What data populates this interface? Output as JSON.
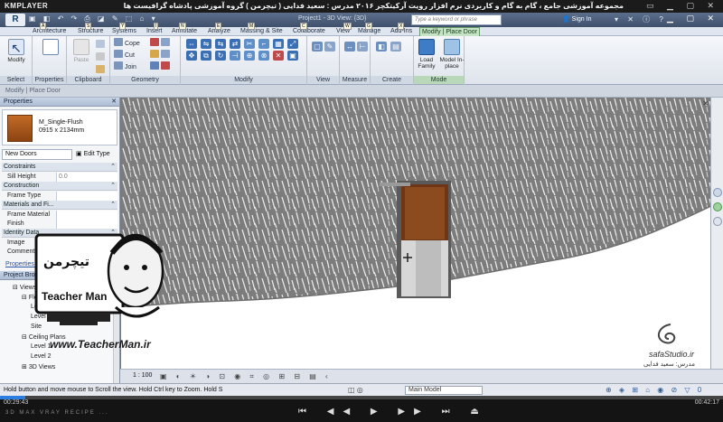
{
  "player": {
    "name": "KMPLAYER",
    "title": "مجموعه آموزشی جامع ، گام به گام و کاربردی نرم افزار رویت آرکیتکچر ۲۰۱۶ مدرس : سعید فدایی ( تیچرمن ) گروه آموزشی پادشاه گرافیست ها",
    "time_current": "00:29:43",
    "time_total": "00:42:17",
    "progress": 0.035,
    "tags": "3D MAX  VRAY  RECIPE  ..."
  },
  "titlebar": {
    "app_button": "R",
    "doc_title": "Project1 - 3D View: {3D}",
    "search_placeholder": "Type a keyword or phrase",
    "signin": "Sign In"
  },
  "tabs": [
    {
      "label": "Architecture",
      "key": "A"
    },
    {
      "label": "Structure",
      "key": "S"
    },
    {
      "label": "Systems",
      "key": "Y"
    },
    {
      "label": "Insert",
      "key": "I"
    },
    {
      "label": "Annotate",
      "key": "N"
    },
    {
      "label": "Analyze",
      "key": "E"
    },
    {
      "label": "Massing & Site",
      "key": "M"
    },
    {
      "label": "Collaborate",
      "key": "C"
    },
    {
      "label": "View",
      "key": "W"
    },
    {
      "label": "Manage",
      "key": "G"
    },
    {
      "label": "Add-Ins",
      "key": "X"
    },
    {
      "label": "Modify | Place Door",
      "key": ""
    }
  ],
  "ribbon": {
    "select": {
      "label": "Select",
      "modify": "Modify"
    },
    "properties": {
      "label": "Properties",
      "button": "Properties"
    },
    "clipboard": {
      "label": "Clipboard",
      "paste": "Paste"
    },
    "geometry": {
      "label": "Geometry",
      "cope": "Cope",
      "cut": "Cut",
      "join": "Join"
    },
    "modify": {
      "label": "Modify"
    },
    "view": {
      "label": "View"
    },
    "measure": {
      "label": "Measure"
    },
    "create": {
      "label": "Create"
    },
    "mode": {
      "label": "Mode",
      "load_family": "Load Family",
      "model_inplace": "Model In-place"
    }
  },
  "options_bar": "Modify | Place Door",
  "properties": {
    "title": "Properties",
    "type_name": "M_Single-Flush",
    "type_size": "0915 x 2134mm",
    "instance": "New Doors",
    "edit_type": "Edit Type",
    "groups": [
      {
        "name": "Constraints",
        "rows": [
          {
            "key": "Sill Height",
            "value": "0.0"
          }
        ]
      },
      {
        "name": "Construction",
        "rows": [
          {
            "key": "Frame Type",
            "value": ""
          }
        ]
      },
      {
        "name": "Materials and Fi...",
        "rows": [
          {
            "key": "Frame Material",
            "value": ""
          },
          {
            "key": "Finish",
            "value": ""
          }
        ]
      },
      {
        "name": "Identity Data",
        "rows": [
          {
            "key": "Image",
            "value": ""
          },
          {
            "key": "Comments",
            "value": ""
          }
        ]
      }
    ],
    "help": "Properties help"
  },
  "browser": {
    "title": "Project Browser - Project1",
    "items": [
      "Views",
      "Floor Plans",
      "Level 1",
      "Level 2",
      "Site",
      "Ceiling Plans",
      "Level 1",
      "Level 2",
      "3D Views"
    ]
  },
  "view_ctrl": {
    "scale": "1 : 100"
  },
  "status": {
    "text": "Hold button and move mouse to Scroll the view. Hold Ctrl key to Zoom. Hold S",
    "model": "Main Model"
  },
  "watermark": {
    "teacher_brand": "Teacher Man",
    "teacher_persian": "تیچرمن",
    "url": "www.TeacherMan.ir",
    "safa": "safaStudio.ir",
    "safa_teacher": "مدرس: سعید فدایی"
  }
}
